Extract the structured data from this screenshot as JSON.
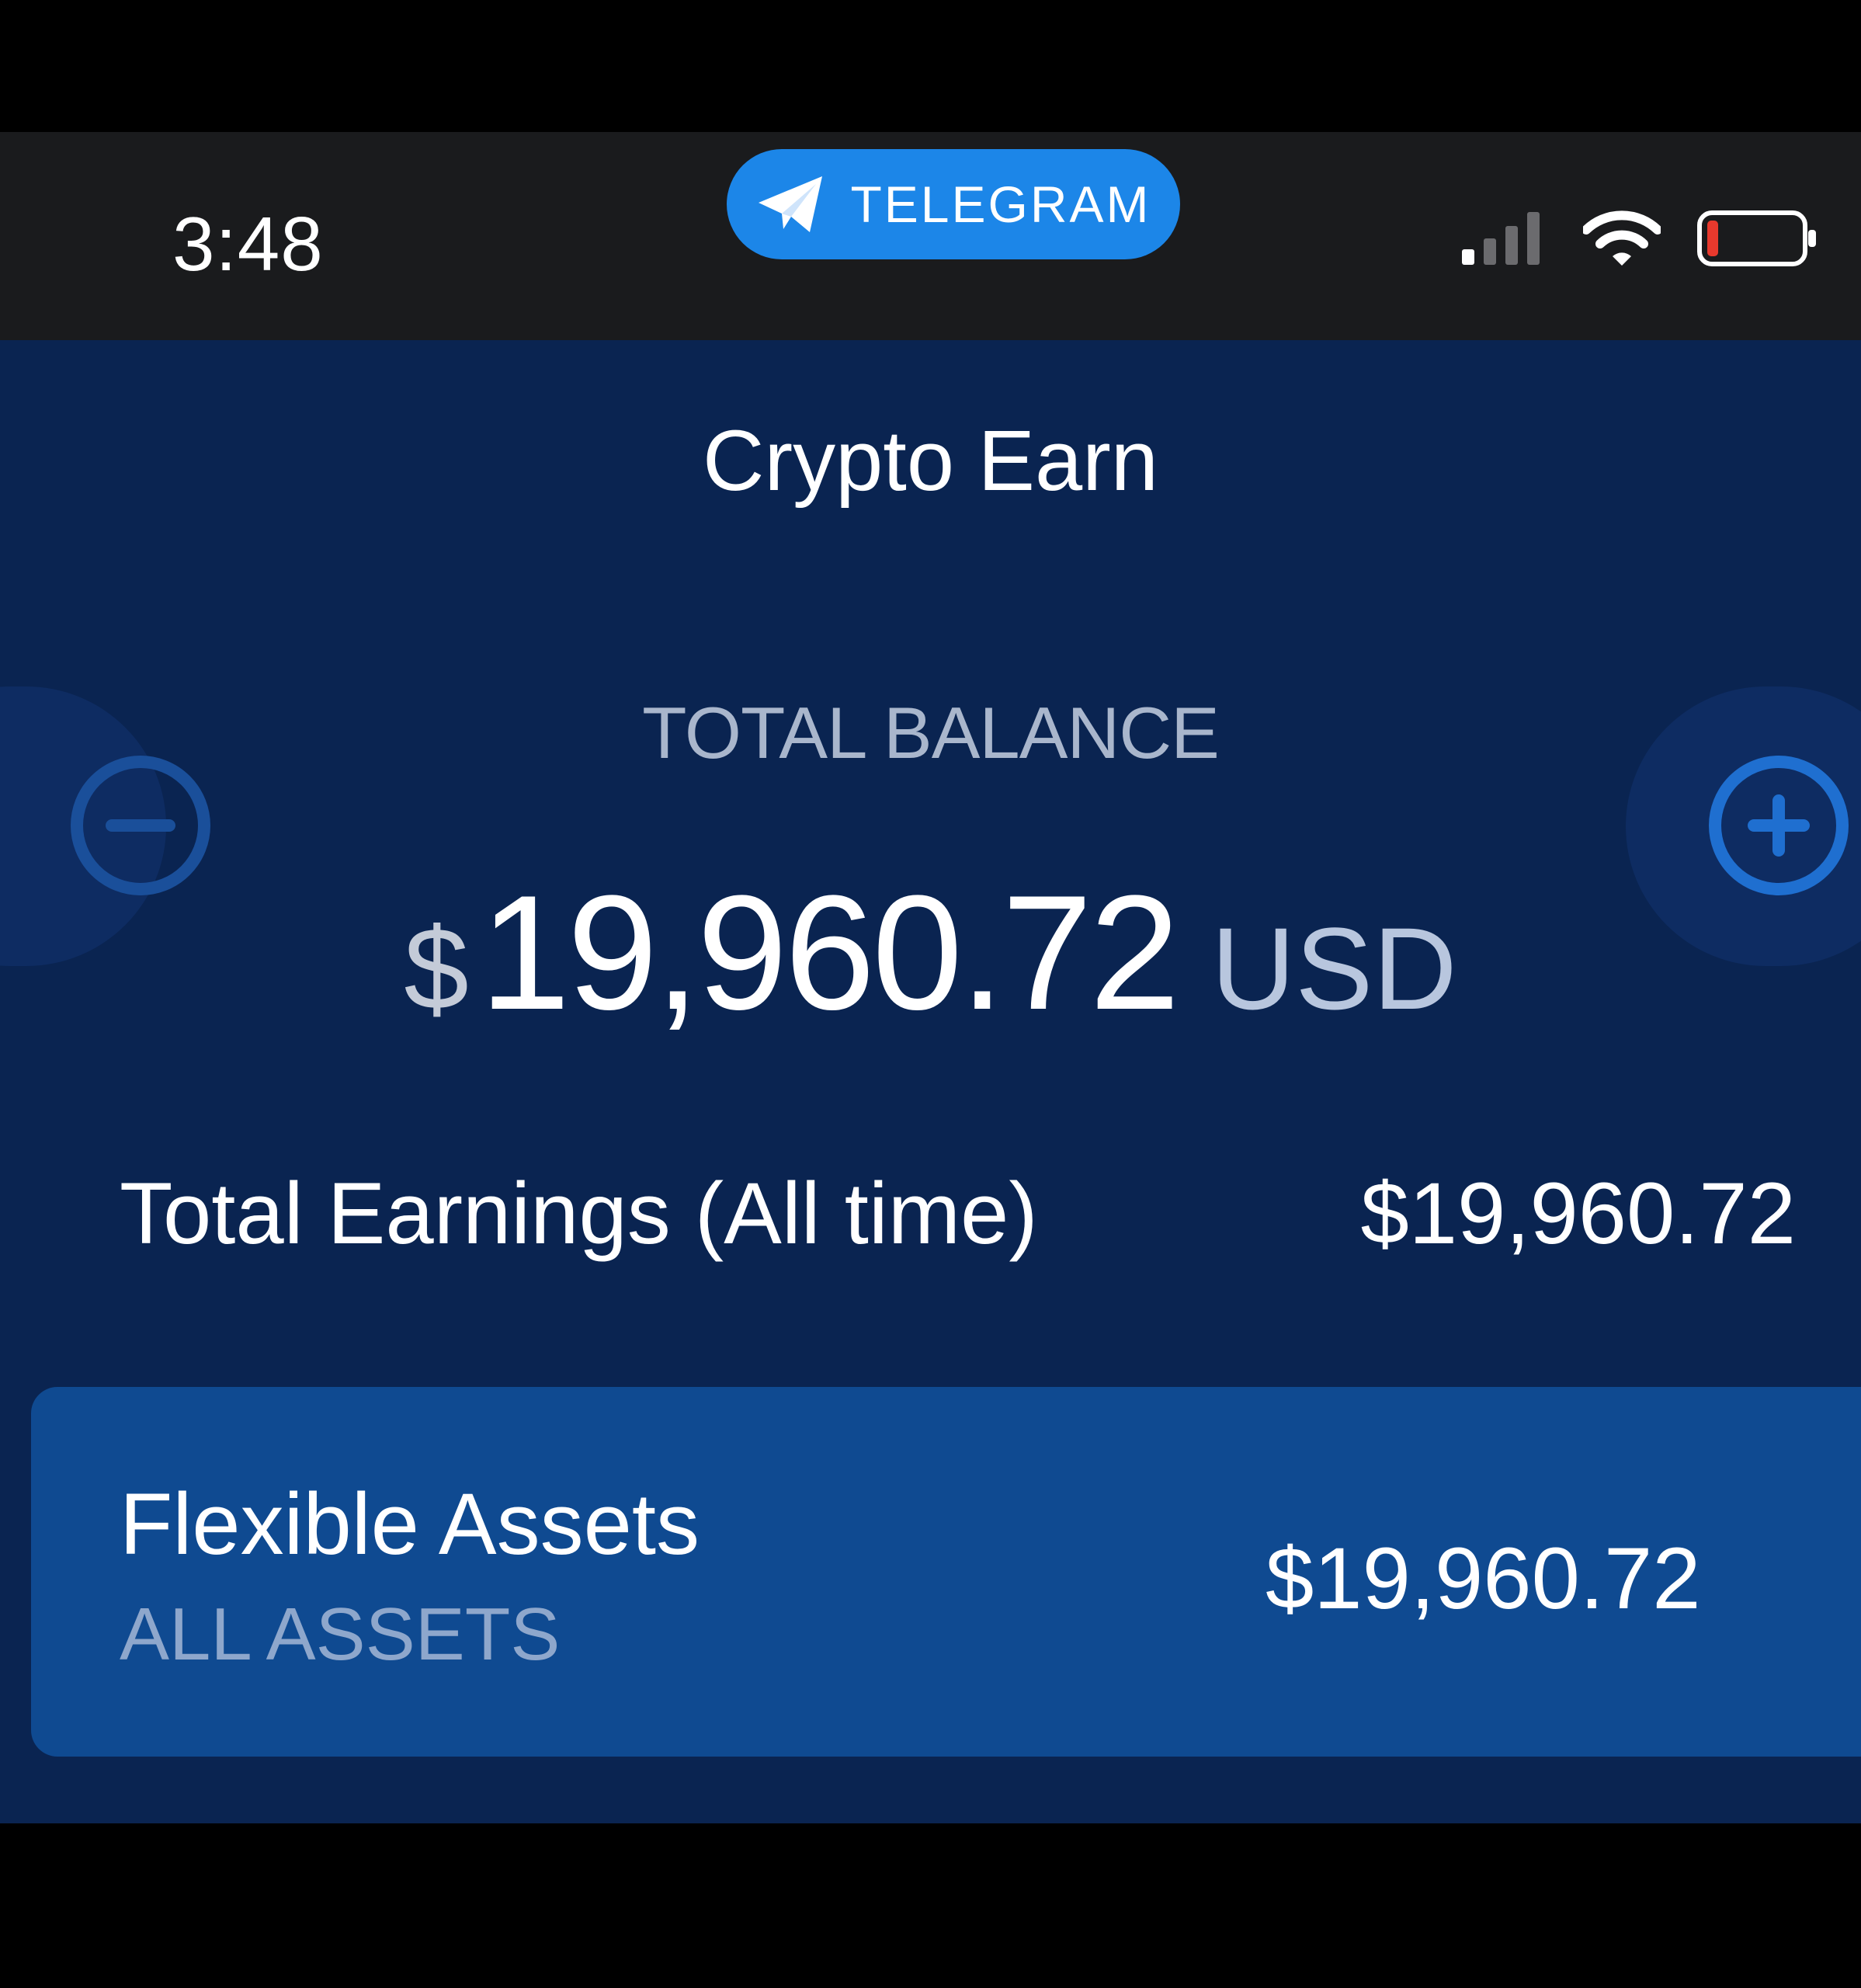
{
  "status_bar": {
    "time": "3:48",
    "return_pill_label": "TELEGRAM",
    "icons": [
      "telegram-plane-icon",
      "cellular-signal-icon",
      "wifi-icon",
      "battery-low-icon"
    ]
  },
  "app": {
    "title": "Crypto Earn",
    "balance": {
      "label": "TOTAL BALANCE",
      "currency_symbol": "$",
      "amount": "19,960.72",
      "currency_code": "USD"
    },
    "earnings": {
      "label": "Total Earnings (All time)",
      "value": "$19,960.72"
    },
    "flexible_card": {
      "title": "Flexible Assets",
      "subtitle": "ALL ASSETS",
      "value": "$19,960.72"
    },
    "actions": {
      "left_icon": "minus-circle-icon",
      "right_icon": "plus-circle-icon"
    }
  },
  "colors": {
    "background": "#0a2451",
    "status_bar": "#1a1b1d",
    "telegram_pill": "#1c86e8",
    "card": "#0f4a91",
    "action_accent": "#1f6fd0",
    "battery_low": "#e8392d"
  }
}
